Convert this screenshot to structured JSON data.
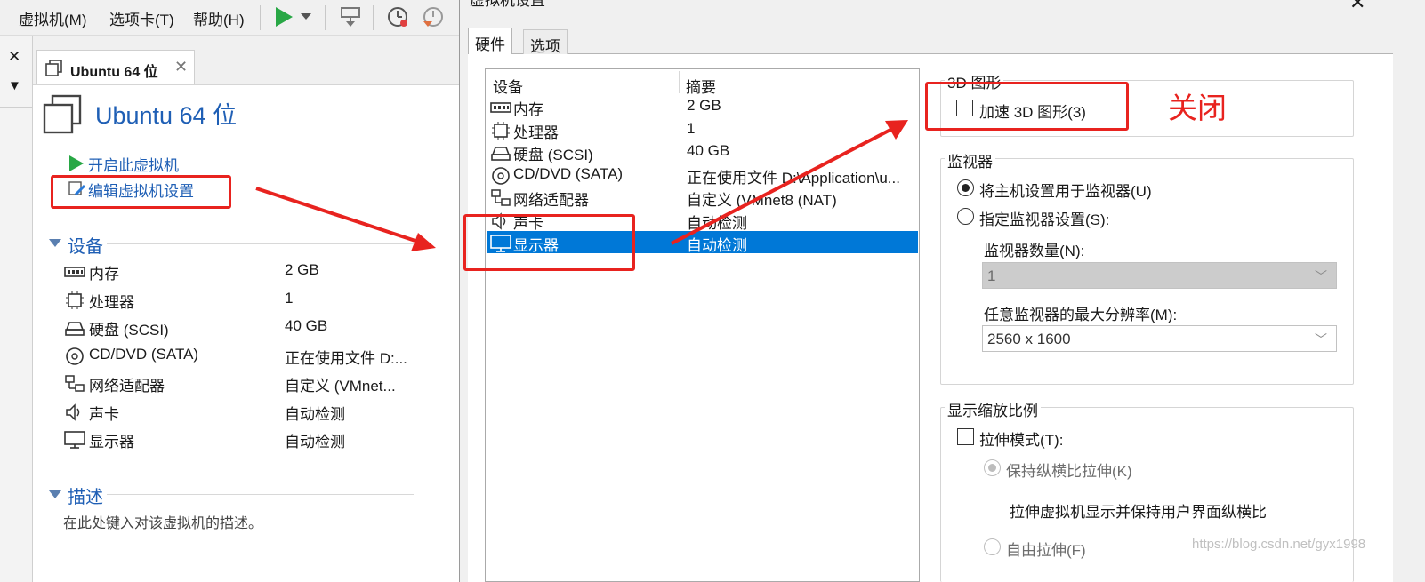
{
  "menubar": {
    "items": [
      "虚拟机(M)",
      "选项卡(T)",
      "帮助(H)"
    ]
  },
  "left_strip": {
    "close_glyph": "✕",
    "dropdown_glyph": "▼"
  },
  "vm_tab": {
    "label": "Ubuntu 64 位",
    "close_glyph": "✕"
  },
  "vm_pane": {
    "title": "Ubuntu 64 位",
    "actions": [
      "开启此虚拟机",
      "编辑虚拟机设置"
    ],
    "devices_heading": "设备",
    "devices": [
      {
        "name": "内存",
        "value": "2 GB",
        "icon": "memory-icon"
      },
      {
        "name": "处理器",
        "value": "1",
        "icon": "processor-icon"
      },
      {
        "name": "硬盘 (SCSI)",
        "value": "40 GB",
        "icon": "harddisk-icon"
      },
      {
        "name": "CD/DVD (SATA)",
        "value": "正在使用文件 D:...",
        "icon": "cd-dvd-icon"
      },
      {
        "name": "网络适配器",
        "value": "自定义 (VMnet...",
        "icon": "network-icon"
      },
      {
        "name": "声卡",
        "value": "自动检测",
        "icon": "sound-icon"
      },
      {
        "name": "显示器",
        "value": "自动检测",
        "icon": "monitor-icon"
      }
    ],
    "desc_heading": "描述",
    "desc_placeholder": "在此处键入对该虚拟机的描述。"
  },
  "dialog": {
    "title": "虚拟机设置",
    "close_glyph": "✕",
    "tabs": [
      "硬件",
      "选项"
    ],
    "list_headers": [
      "设备",
      "摘要"
    ],
    "list_rows": [
      {
        "name": "内存",
        "value": "2 GB",
        "icon": "memory-icon"
      },
      {
        "name": "处理器",
        "value": "1",
        "icon": "processor-icon"
      },
      {
        "name": "硬盘 (SCSI)",
        "value": "40 GB",
        "icon": "harddisk-icon"
      },
      {
        "name": "CD/DVD (SATA)",
        "value": "正在使用文件 D:\\Application\\u...",
        "icon": "cd-dvd-icon"
      },
      {
        "name": "网络适配器",
        "value": "自定义 (VMnet8 (NAT)",
        "icon": "network-icon"
      },
      {
        "name": "声卡",
        "value": "自动检测",
        "icon": "sound-icon"
      },
      {
        "name": "显示器",
        "value": "自动检测",
        "icon": "monitor-icon",
        "selected": true
      }
    ],
    "g3d": {
      "title": "3D 图形",
      "accel_label": "加速 3D 图形(3)",
      "accel_checked": false
    },
    "monitor": {
      "title": "监视器",
      "opt_host": "将主机设置用于监视器(U)",
      "opt_custom": "指定监视器设置(S):",
      "count_label": "监视器数量(N):",
      "count_value": "1",
      "res_label": "任意监视器的最大分辨率(M):",
      "res_value": "2560 x 1600"
    },
    "scale": {
      "title": "显示缩放比例",
      "stretch_label": "拉伸模式(T):",
      "keep_aspect": "保持纵横比拉伸(K)",
      "keep_desc": "拉伸虚拟机显示并保持用户界面纵横比",
      "free_stretch": "自由拉伸(F)"
    }
  },
  "annotation": {
    "note": "关闭",
    "color": "#e8231f"
  },
  "watermark": "https://blog.csdn.net/gyx1998"
}
